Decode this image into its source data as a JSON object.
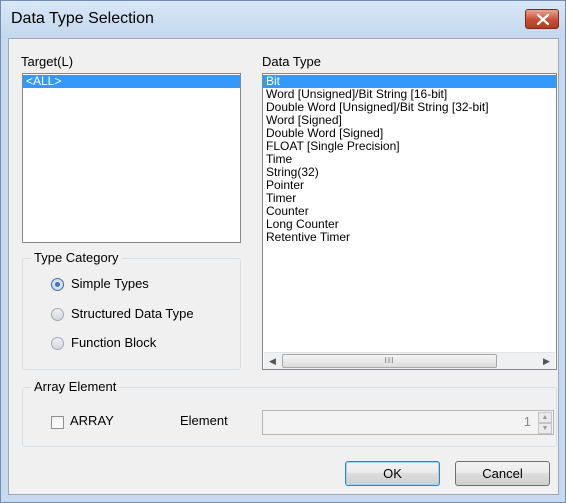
{
  "window": {
    "title": "Data Type Selection"
  },
  "target": {
    "label": "Target(L)",
    "items": [
      "<ALL>"
    ],
    "selected_index": 0
  },
  "data_type": {
    "label": "Data Type",
    "items": [
      "Bit",
      "Word [Unsigned]/Bit String [16-bit]",
      "Double Word [Unsigned]/Bit String [32-bit]",
      "Word [Signed]",
      "Double Word [Signed]",
      "FLOAT [Single Precision]",
      "Time",
      "String(32)",
      "Pointer",
      "Timer",
      "Counter",
      "Long Counter",
      "Retentive Timer"
    ],
    "selected_index": 0,
    "scrollbar_thumb_glyph": "III"
  },
  "type_category": {
    "label": "Type Category",
    "options": [
      {
        "label": "Simple Types",
        "checked": true
      },
      {
        "label": "Structured Data Type",
        "checked": false
      },
      {
        "label": "Function Block",
        "checked": false
      }
    ]
  },
  "array_element": {
    "label": "Array Element",
    "array_checkbox_label": "ARRAY",
    "array_checked": false,
    "element_label": "Element",
    "element_value": "1"
  },
  "buttons": {
    "ok": "OK",
    "cancel": "Cancel"
  },
  "colors": {
    "selection": "#3399ff",
    "title_bar": "#c7d9ee",
    "close_button": "#c94e36",
    "dialog_background": "#f0f0f0"
  }
}
